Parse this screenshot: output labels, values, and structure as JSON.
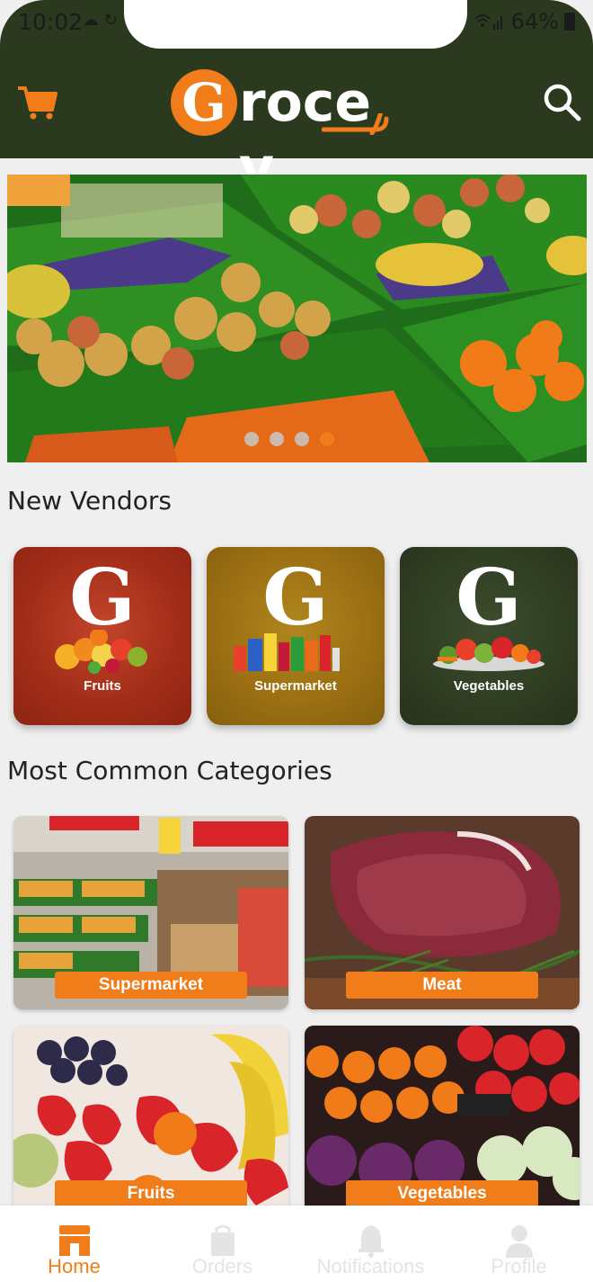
{
  "status_bar": {
    "time": "10:02",
    "left_icons": "☁ ↻",
    "battery": "64%"
  },
  "header": {
    "logo_letter": "G",
    "logo_text": "roce y",
    "cart_icon": "shopping-cart-icon",
    "search_icon": "search-icon"
  },
  "banner": {
    "slides": 4,
    "active_slide": 4
  },
  "new_vendors": {
    "title": "New Vendors",
    "items": [
      {
        "letter": "G",
        "label": "Fruits",
        "color": "#a8321c"
      },
      {
        "letter": "G",
        "label": "Supermarket",
        "color": "#9a6e12"
      },
      {
        "letter": "G",
        "label": "Vegetables",
        "color": "#2f3d22"
      }
    ]
  },
  "categories": {
    "title": "Most Common Categories",
    "items": [
      {
        "label": "Supermarket"
      },
      {
        "label": "Meat"
      },
      {
        "label": "Fruits"
      },
      {
        "label": "Vegetables"
      }
    ]
  },
  "bottom_nav": {
    "items": [
      {
        "label": "Home",
        "icon": "home-store-icon",
        "active": true
      },
      {
        "label": "Orders",
        "icon": "orders-bag-icon",
        "active": false
      },
      {
        "label": "Notifications",
        "icon": "bell-icon",
        "active": false
      },
      {
        "label": "Profile",
        "icon": "person-icon",
        "active": false
      }
    ]
  },
  "colors": {
    "header_bg": "#2b3a1f",
    "accent": "#f07d1a",
    "page_bg": "#efefef"
  }
}
